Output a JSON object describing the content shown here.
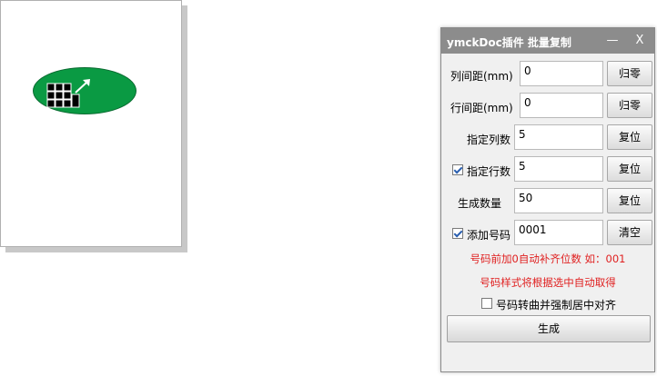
{
  "dialog": {
    "title": "ymckDoc插件  批量复制",
    "minimize_label": "—",
    "close_label": "X",
    "col_spacing": {
      "label": "列间距(mm)",
      "value": "0",
      "button": "归零"
    },
    "row_spacing": {
      "label": "行间距(mm)",
      "value": "0",
      "button": "归零"
    },
    "col_count": {
      "label": "指定列数",
      "value": "5",
      "button": "复位"
    },
    "row_count": {
      "label": "指定行数",
      "value": "5",
      "button": "复位",
      "checked": true
    },
    "gen_count": {
      "label": "生成数量",
      "value": "50",
      "button": "复位"
    },
    "add_number": {
      "label": "添加号码",
      "value": "0001",
      "button": "清空",
      "checked": true
    },
    "hint1": "号码前加0自动补齐位数 如：001",
    "hint2": "号码样式将根据选中自动取得",
    "curve_option": {
      "label": "号码转曲并强制居中对齐",
      "checked": false
    },
    "generate_label": "生成"
  },
  "colors": {
    "ellipse_fill": "#0a9a43",
    "titlebar": "#8c8c8c",
    "hint_text": "#e02020"
  }
}
